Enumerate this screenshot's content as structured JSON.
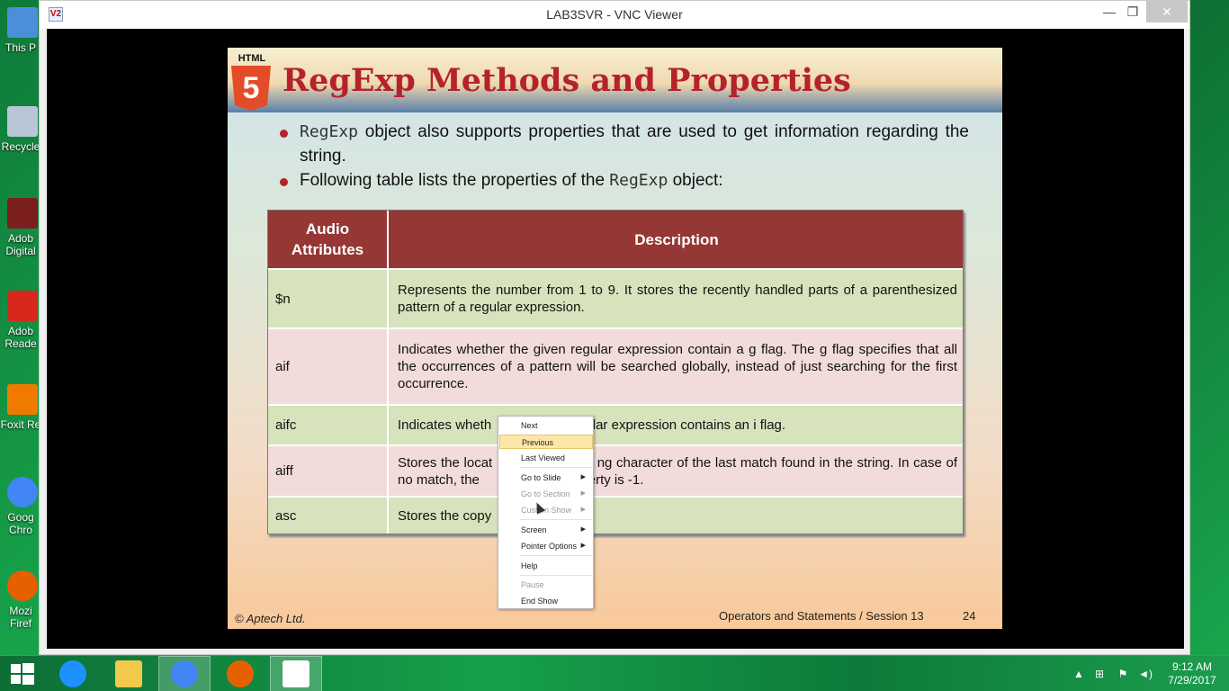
{
  "desktop": {
    "icons": [
      {
        "label": "This P",
        "color": "#4a90d9"
      },
      {
        "label": "Recycle",
        "color": "#b8c7d6"
      },
      {
        "label": "Adob Digital",
        "color": "#7a1e1e"
      },
      {
        "label": "Adob Reade",
        "color": "#d8281c"
      },
      {
        "label": "Foxit Re",
        "color": "#f07a00"
      },
      {
        "label": "Goog Chro",
        "color": "#4285f4"
      },
      {
        "label": "Mozi Firef",
        "color": "#e66000"
      }
    ]
  },
  "window": {
    "title": "LAB3SVR - VNC Viewer",
    "logo": "V2",
    "minimize": "—",
    "maximize": "❐",
    "close": "✕"
  },
  "slide": {
    "html5_label": "HTML",
    "html5_number": "5",
    "title": "RegExp Methods and Properties",
    "bullet1_code": "RegExp",
    "bullet1_text": " object also supports properties that are used to get information regarding the string.",
    "bullet2_text": "Following table lists the properties of the ",
    "bullet2_code": "RegExp",
    "bullet2_end": " object:",
    "table": {
      "header_attr": "Audio Attributes",
      "header_desc": "Description",
      "rows": [
        {
          "attr": "$n",
          "desc": "Represents the number from 1 to 9. It stores the recently handled parts of a parenthesized pattern of a regular expression."
        },
        {
          "attr": "aif",
          "desc": "Indicates whether the given regular expression contain a g flag. The g flag specifies that all the occurrences of a pattern will be searched globally, instead of just searching for the first occurrence."
        },
        {
          "attr": "aifc",
          "desc": "Indicates wheth                         ular expression contains an i flag."
        },
        {
          "attr": "aiff",
          "desc": "Stores the locat                         ng character of the last match found in the string. In case of no match, the                         operty is -1."
        },
        {
          "attr": "asc",
          "desc": "Stores the copy"
        }
      ]
    },
    "footer_left": "© Aptech Ltd.",
    "footer_right": "Operators and Statements / Session 13",
    "page_number": "24"
  },
  "context_menu": {
    "items": [
      {
        "label": "Next",
        "disabled": false,
        "submenu": false
      },
      {
        "label": "Previous",
        "disabled": false,
        "submenu": false
      },
      {
        "label": "Last Viewed",
        "disabled": false,
        "submenu": false
      },
      {
        "label": "Go to Slide",
        "disabled": false,
        "submenu": true
      },
      {
        "label": "Go to Section",
        "disabled": true,
        "submenu": true
      },
      {
        "label": "Custom Show",
        "disabled": true,
        "submenu": true
      },
      {
        "label": "Screen",
        "disabled": false,
        "submenu": true
      },
      {
        "label": "Pointer Options",
        "disabled": false,
        "submenu": true
      },
      {
        "label": "Help",
        "disabled": false,
        "submenu": false
      },
      {
        "label": "Pause",
        "disabled": true,
        "submenu": false
      },
      {
        "label": "End Show",
        "disabled": false,
        "submenu": false
      }
    ],
    "selected": "Previous",
    "submenu_arrow": "▶"
  },
  "taskbar": {
    "apps": [
      {
        "name": "internet-explorer",
        "color": "#1e90ff"
      },
      {
        "name": "file-explorer",
        "color": "#f2c94c"
      },
      {
        "name": "chrome",
        "color": "#4285f4"
      },
      {
        "name": "firefox",
        "color": "#e66000"
      },
      {
        "name": "vnc-viewer",
        "color": "#ffffff"
      }
    ],
    "tray_arrow": "▲",
    "tray_network": "⊞",
    "tray_flag": "⚑",
    "tray_volume": "◄)",
    "time": "9:12 AM",
    "date": "7/29/2017"
  }
}
